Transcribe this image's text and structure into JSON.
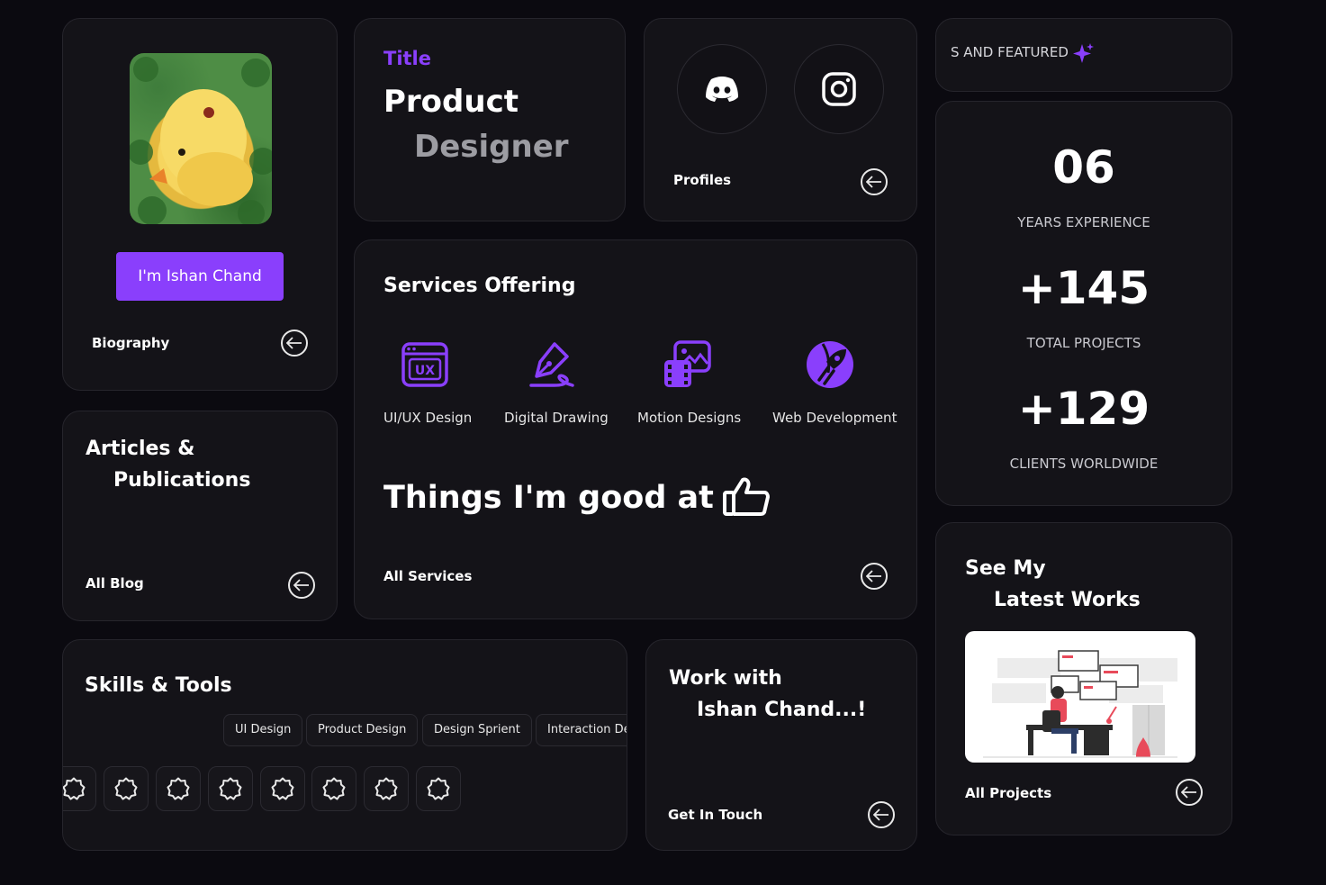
{
  "colors": {
    "accent": "#8a3ffc",
    "background": "#0b0a10",
    "card": "#141318"
  },
  "bio": {
    "name_button": "I'm Ishan Chand",
    "footer": "Biography"
  },
  "title_card": {
    "eyebrow": "Title",
    "line1": "Product",
    "line2": "Designer"
  },
  "profiles": {
    "footer": "Profiles",
    "icons": [
      "discord-icon",
      "instagram-icon"
    ]
  },
  "marquee": {
    "text": "S AND FEATURED"
  },
  "stats": [
    {
      "value": "06",
      "label": "YEARS EXPERIENCE"
    },
    {
      "value": "+145",
      "label": "TOTAL PROJECTS"
    },
    {
      "value": "+129",
      "label": "CLIENTS WORLDWIDE"
    }
  ],
  "services": {
    "heading": "Services Offering",
    "items": [
      {
        "label": "UI/UX Design",
        "icon": "ux-icon"
      },
      {
        "label": "Digital Drawing",
        "icon": "pen-tool-icon"
      },
      {
        "label": "Motion Designs",
        "icon": "motion-icon"
      },
      {
        "label": "Web Development",
        "icon": "rocket-icon"
      }
    ],
    "tagline": "Things I'm good at",
    "footer": "All Services"
  },
  "articles": {
    "line1": "Articles &",
    "line2": "Publications",
    "footer": "All Blog"
  },
  "skills": {
    "heading": "Skills & Tools",
    "tags": [
      "UI Design",
      "Product Design",
      "Design Sprient",
      "Interaction Design"
    ]
  },
  "work": {
    "line1": "Work with",
    "line2": "Ishan Chand...!",
    "footer": "Get In Touch"
  },
  "latest": {
    "line1": "See My",
    "line2": "Latest Works",
    "footer": "All Projects"
  }
}
